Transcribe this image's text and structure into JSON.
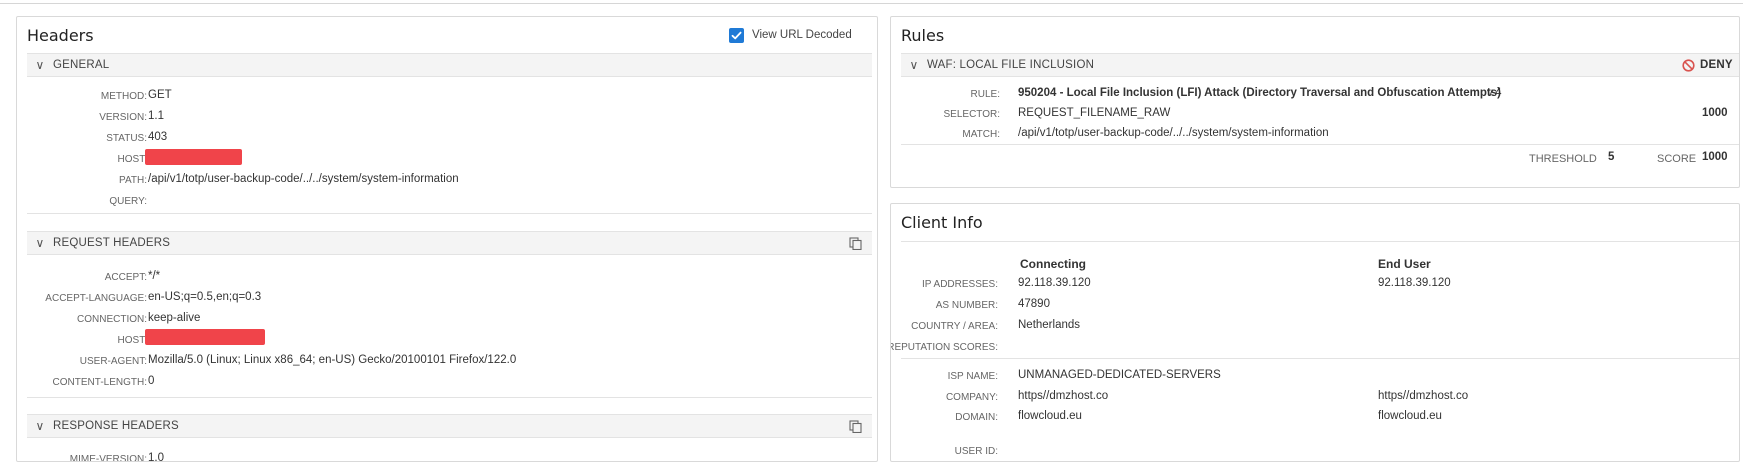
{
  "headers_panel": {
    "title": "Headers",
    "view_url_decoded_label": "View URL Decoded",
    "view_url_decoded_checked": true,
    "general": {
      "title": "GENERAL",
      "rows": [
        {
          "label": "METHOD:",
          "value": "GET"
        },
        {
          "label": "VERSION:",
          "value": "1.1"
        },
        {
          "label": "STATUS:",
          "value": "403"
        },
        {
          "label": "HOST:",
          "value": "",
          "redacted": true
        },
        {
          "label": "PATH:",
          "value": "/api/v1/totp/user-backup-code/../../system/system-information"
        },
        {
          "label": "QUERY:",
          "value": ""
        }
      ]
    },
    "request_headers": {
      "title": "REQUEST HEADERS",
      "rows": [
        {
          "label": "ACCEPT:",
          "value": "*/*"
        },
        {
          "label": "ACCEPT-LANGUAGE:",
          "value": "en-US;q=0.5,en;q=0.3"
        },
        {
          "label": "CONNECTION:",
          "value": "keep-alive"
        },
        {
          "label": "HOST:",
          "value": "",
          "redacted": true
        },
        {
          "label": "USER-AGENT:",
          "value": "Mozilla/5.0 (Linux; Linux x86_64; en-US) Gecko/20100101 Firefox/122.0"
        },
        {
          "label": "CONTENT-LENGTH:",
          "value": "0"
        }
      ]
    },
    "response_headers": {
      "title": "RESPONSE HEADERS",
      "rows": [
        {
          "label": "MIME-VERSION:",
          "value": "1.0"
        }
      ]
    }
  },
  "rules_panel": {
    "title": "Rules",
    "section_title": "WAF: LOCAL FILE INCLUSION",
    "action": "DENY",
    "rule_label": "RULE:",
    "rule_value": "950204 - Local File Inclusion (LFI) Attack (Directory Traversal and Obfuscation Attempts)",
    "rule_version": "v.4",
    "selector_label": "SELECTOR:",
    "selector_value": "REQUEST_FILENAME_RAW",
    "match_label": "MATCH:",
    "match_value": "/api/v1/totp/user-backup-code/../../system/system-information",
    "rule_score": "1000",
    "threshold_label": "THRESHOLD",
    "threshold_value": "5",
    "score_label": "SCORE",
    "score_value": "1000"
  },
  "client_panel": {
    "title": "Client Info",
    "col_connecting": "Connecting",
    "col_end_user": "End User",
    "rows": [
      {
        "label": "IP ADDRESSES:",
        "connecting": "92.118.39.120",
        "end_user": "92.118.39.120"
      },
      {
        "label": "AS NUMBER:",
        "connecting": "47890",
        "end_user": ""
      },
      {
        "label": "COUNTRY / AREA:",
        "connecting": "Netherlands",
        "end_user": ""
      },
      {
        "label": "REPUTATION SCORES:",
        "connecting": "",
        "end_user": ""
      }
    ],
    "rows2": [
      {
        "label": "ISP NAME:",
        "connecting": "UNMANAGED-DEDICATED-SERVERS",
        "end_user": ""
      },
      {
        "label": "COMPANY:",
        "connecting": "https//dmzhost.co",
        "end_user": "https//dmzhost.co"
      },
      {
        "label": "DOMAIN:",
        "connecting": "flowcloud.eu",
        "end_user": "flowcloud.eu"
      },
      {
        "label": "USER ID:",
        "connecting": "",
        "end_user": ""
      }
    ]
  },
  "colors": {
    "accent_blue": "#1f7ad6",
    "redaction": "#f0444a",
    "deny_red": "#d9534f"
  }
}
